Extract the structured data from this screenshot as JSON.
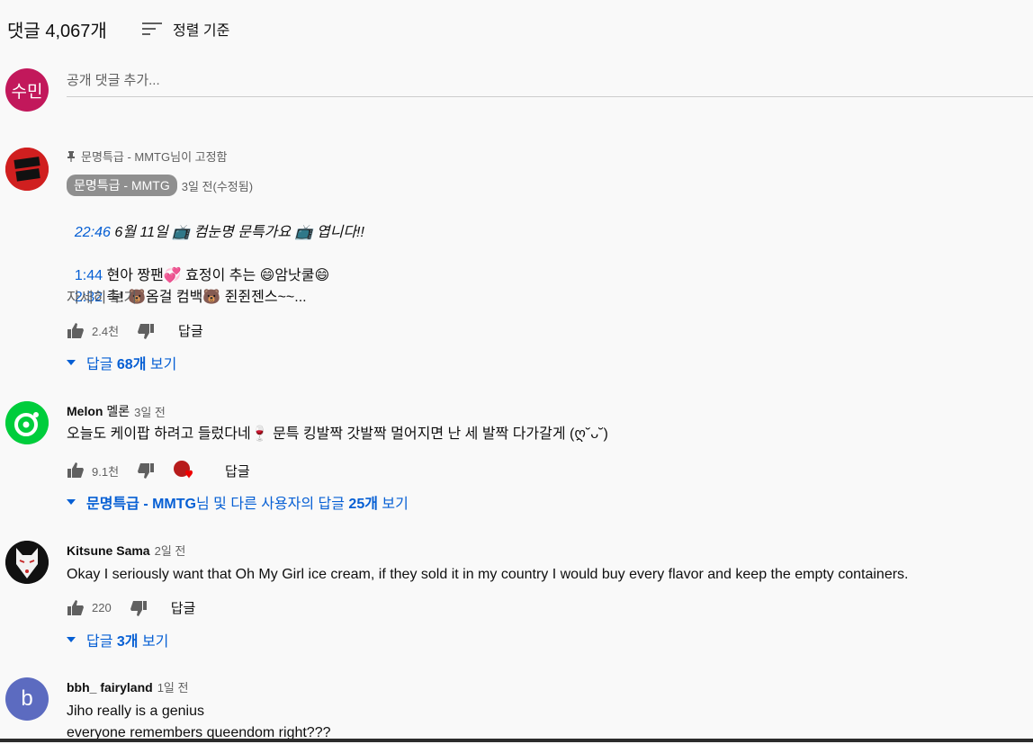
{
  "header": {
    "comment_count": "댓글 4,067개",
    "sort_label": "정렬 기준",
    "add_comment_placeholder": "공개 댓글 추가...",
    "user_avatar_text": "수민"
  },
  "comments": [
    {
      "pinned_label": "문명특급 - MMTG님이 고정함",
      "author": "문명특급 - MMTG",
      "time": "3일 전(수정됨)",
      "line1_ts": "22:46",
      "line1": " 6월 11일 📺 컴눈명 문특가요 📺 엽니다!!",
      "line2_ts": "1:44",
      "line2": " 현아 짱팬💞 효정이 추는 😄암낫쿨😄",
      "line3_ts": "2:32",
      "line3": " 축! 🐻옴걸 컴백🐻 쥔쥔젠스~~...",
      "more": "자세히 보기",
      "likes": "2.4천",
      "reply_btn": "답글",
      "replies_prefix": "답글 ",
      "replies_count": "68개",
      "replies_suffix": " 보기"
    },
    {
      "author": "Melon",
      "author2": "멜론",
      "time": "3일 전",
      "text": "오늘도 케이팝 하려고 들렀다네🍷 문특 킹발짝 갓발짝 멀어지면 난 세 발짝 다가갈게 (ღ˘ᴗ˘)",
      "likes": "9.1천",
      "reply_btn": "답글",
      "replies_name": "문명특급 - MMTG",
      "replies_mid": "님 및 다른 사용자의 답글 ",
      "replies_count": "25개",
      "replies_suffix": " 보기"
    },
    {
      "author": "Kitsune Sama",
      "time": "2일 전",
      "text": "Okay I seriously want that Oh My Girl ice cream, if they sold it in my country I would buy every flavor and keep the empty containers.",
      "likes": "220",
      "reply_btn": "답글",
      "replies_prefix": "답글 ",
      "replies_count": "3개",
      "replies_suffix": " 보기"
    },
    {
      "author": "bbh_ fairyland",
      "time": "1일 전",
      "avatar_letter": "b",
      "line1": "Jiho really is a genius",
      "line2": "everyone remembers queendom right???"
    }
  ],
  "colors": {
    "link": "#065fd4",
    "melon_green": "#00cd3c",
    "user_avatar": "#c2185b",
    "b_avatar": "#5c6bc0"
  }
}
